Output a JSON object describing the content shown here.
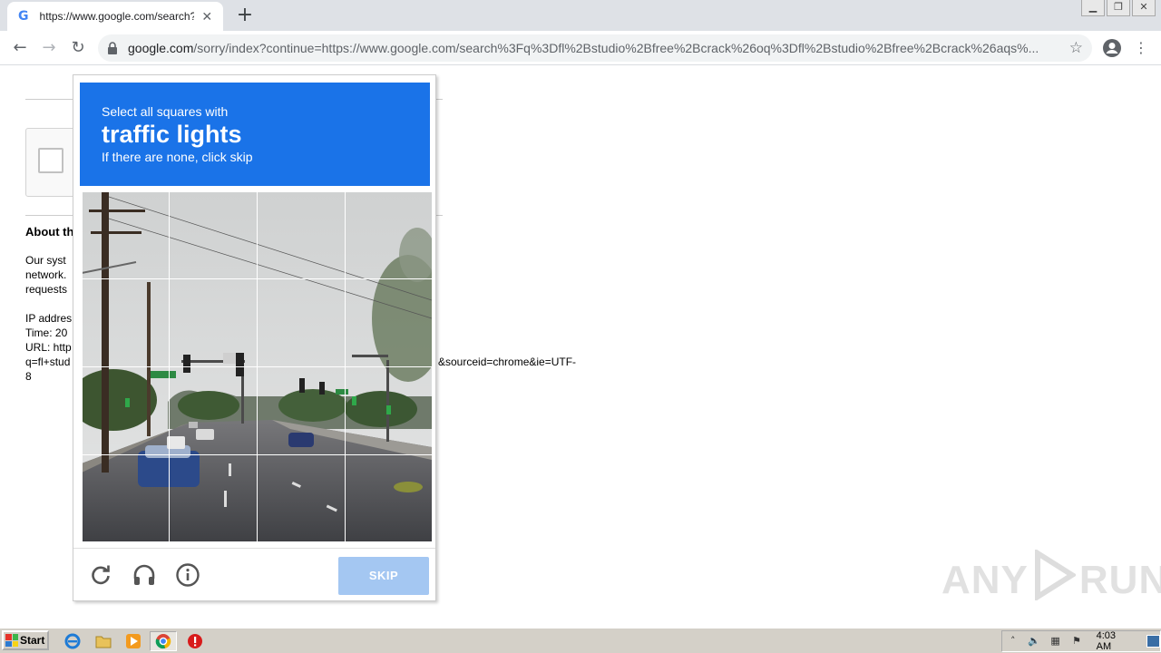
{
  "browser": {
    "tab_title": "https://www.google.com/search?q=",
    "url_domain": "google.com",
    "url_rest": "/sorry/index?continue=https://www.google.com/search%3Fq%3Dfl%2Bstudio%2Bfree%2Bcrack%26oq%3Dfl%2Bstudio%2Bfree%2Bcrack%26aqs%..."
  },
  "page": {
    "about_heading": "About th",
    "para_line1": "Our syst",
    "para_line2": "network.",
    "para_line3": "requests",
    "ip_label": "IP addres",
    "time_label": "Time: 20",
    "url_label": "URL: http",
    "url_line2_left": "q=fl+stud",
    "url_line2_right": "&sourceid=chrome&ie=UTF-",
    "url_line3": "8"
  },
  "challenge": {
    "instruction": "Select all squares with",
    "keyword": "traffic lights",
    "hint": "If there are none, click skip",
    "skip_label": "SKIP",
    "grid_size": 4,
    "header_color": "#1a73e8",
    "skip_color": "#a4c7f2"
  },
  "taskbar": {
    "start_label": "Start",
    "clock": "4:03 AM"
  },
  "watermark": {
    "left": "ANY",
    "right": "RUN"
  }
}
